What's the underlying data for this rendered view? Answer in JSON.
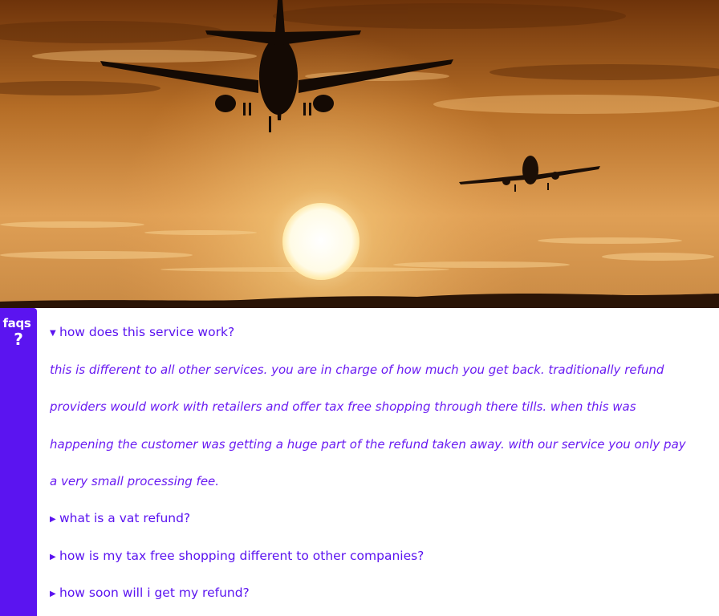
{
  "hero": {
    "image_description": "airplanes flying at sunset",
    "colors": {
      "sky_top": "#7a3a0c",
      "sky_mid": "#c97e30",
      "sky_low": "#e8a85a",
      "sun": "#fff6d8",
      "silhouette": "#1a0d05"
    }
  },
  "sidebar": {
    "label": "faqs",
    "icon": "?",
    "color": "#5b14f0"
  },
  "faqs": [
    {
      "question": "how does this service work?",
      "expanded": true,
      "answer_lines": [
        "this is different to all other services. you are in charge of how much you get back. traditionally refund",
        "providers would work with retailers and offer tax free shopping through there tills. when this was",
        "happening the customer was getting a huge part of the refund taken away. with our service you only pay",
        "a very small processing fee."
      ]
    },
    {
      "question": "what is a vat refund?",
      "expanded": false
    },
    {
      "question": "how is my tax free shopping different to other companies?",
      "expanded": false
    },
    {
      "question": "how soon will i get my refund?",
      "expanded": false
    }
  ],
  "indicators": {
    "expanded": "▼",
    "collapsed": "▶"
  }
}
